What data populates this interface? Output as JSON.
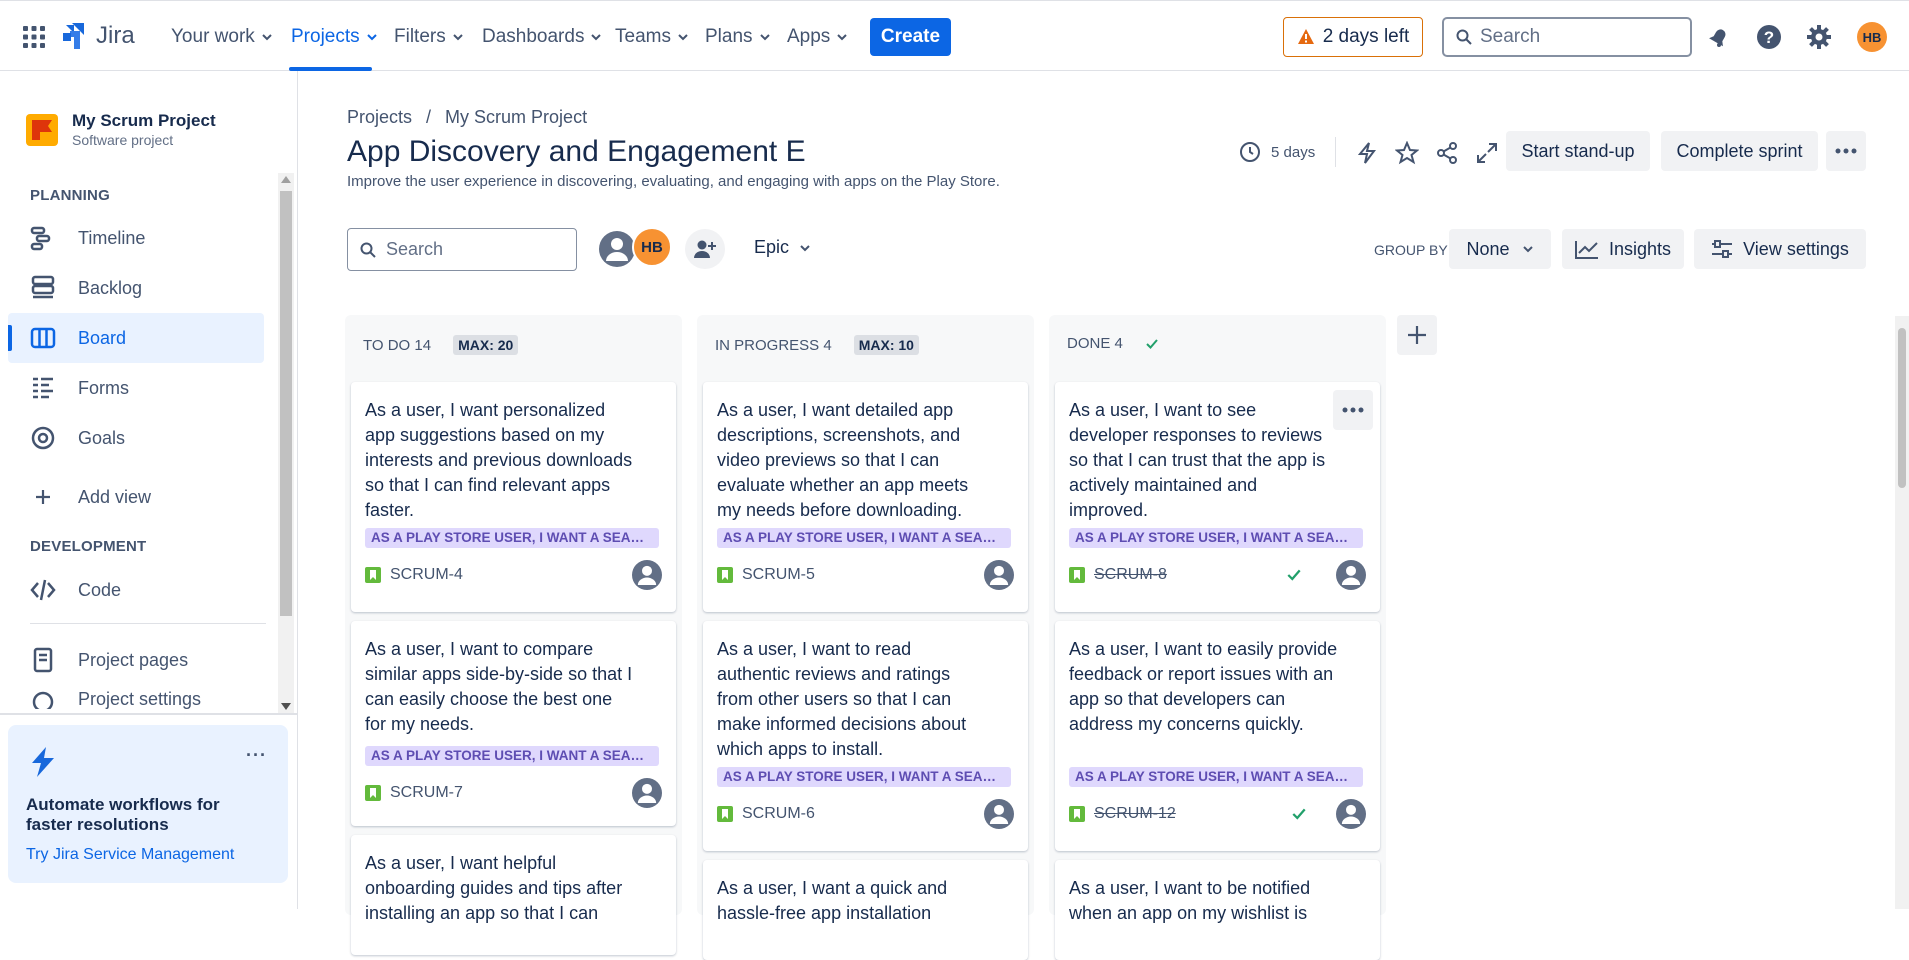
{
  "topnav": {
    "app_name": "Jira",
    "items": [
      {
        "label": "Your work"
      },
      {
        "label": "Projects"
      },
      {
        "label": "Filters"
      },
      {
        "label": "Dashboards"
      },
      {
        "label": "Teams"
      },
      {
        "label": "Plans"
      },
      {
        "label": "Apps"
      }
    ],
    "create_label": "Create",
    "trial_label": "2 days left",
    "search_placeholder": "Search",
    "avatar_initials": "HB"
  },
  "sidebar": {
    "project_name": "My Scrum Project",
    "project_type": "Software project",
    "planning_heading": "PLANNING",
    "planning_items": [
      {
        "label": "Timeline"
      },
      {
        "label": "Backlog"
      },
      {
        "label": "Board"
      },
      {
        "label": "Forms"
      },
      {
        "label": "Goals"
      }
    ],
    "add_view_label": "Add view",
    "development_heading": "DEVELOPMENT",
    "code_label": "Code",
    "project_pages_label": "Project pages",
    "project_settings_label": "Project settings",
    "promo_title": "Automate workflows for faster resolutions",
    "promo_link": "Try Jira Service Management"
  },
  "header": {
    "breadcrumb": [
      "Projects",
      "My Scrum Project"
    ],
    "title": "App Discovery and Engagement E",
    "subtitle": "Improve the user experience in discovering, evaluating, and engaging with apps on the Play Store.",
    "days_remaining": "5 days",
    "standup_label": "Start stand-up",
    "complete_label": "Complete sprint"
  },
  "filters": {
    "search_placeholder": "Search",
    "avatar_initials": "HB",
    "epic_label": "Epic",
    "group_by_label": "GROUP BY",
    "group_by_value": "None",
    "insights_label": "Insights",
    "view_settings_label": "View settings"
  },
  "columns": [
    {
      "name": "TO DO 14",
      "max": "MAX: 20",
      "cards": [
        {
          "text": "As a user, I want personalized app suggestions based on my interests and previous downloads so that I can find relevant apps faster.",
          "epic": "AS A PLAY STORE USER, I WANT A SEAMLESS APP DISCOVERY EXPERIENCE",
          "key": "SCRUM-4"
        },
        {
          "text": "As a user, I want to compare similar apps side-by-side so that I can easily choose the best one for my needs.",
          "epic": "AS A PLAY STORE USER, I WANT A SEAMLESS APP DISCOVERY EXPERIENCE",
          "key": "SCRUM-7"
        },
        {
          "text": "As a user, I want helpful onboarding guides and tips after installing an app so that I can",
          "epic": "",
          "key": ""
        }
      ]
    },
    {
      "name": "IN PROGRESS 4",
      "max": "MAX: 10",
      "cards": [
        {
          "text": "As a user, I want detailed app descriptions, screenshots, and video previews so that I can evaluate whether an app meets my needs before downloading.",
          "epic": "AS A PLAY STORE USER, I WANT A SEAMLESS APP DISCOVERY EXPERIENCE",
          "key": "SCRUM-5"
        },
        {
          "text": "As a user, I want to read authentic reviews and ratings from other users so that I can make informed decisions about which apps to install.",
          "epic": "AS A PLAY STORE USER, I WANT A SEAMLESS APP DISCOVERY EXPERIENCE",
          "key": "SCRUM-6"
        },
        {
          "text": "As a user, I want a quick and hassle-free app installation",
          "epic": "",
          "key": ""
        }
      ]
    },
    {
      "name": "DONE 4",
      "max": "",
      "cards": [
        {
          "text": "As a user, I want to see developer responses to reviews so that I can trust that the app is actively maintained and improved.",
          "epic": "AS A PLAY STORE USER, I WANT A SEAMLESS APP DISCOVERY EXPERIENCE",
          "key": "SCRUM-8"
        },
        {
          "text": "As a user, I want to easily provide feedback or report issues with an app so that developers can address my concerns quickly.",
          "epic": "AS A PLAY STORE USER, I WANT A SEAMLESS APP DISCOVERY EXPERIENCE",
          "key": "SCRUM-12"
        },
        {
          "text": "As a user, I want to be notified when an app on my wishlist is",
          "epic": "",
          "key": ""
        }
      ]
    }
  ],
  "colors": {
    "primary": "#0c66e4",
    "epic_bg": "#dfd8fd",
    "epic_text": "#5e4db2",
    "story_green": "#63ba3c",
    "done_check": "#22a06b",
    "avatar_orange": "#f79232"
  }
}
